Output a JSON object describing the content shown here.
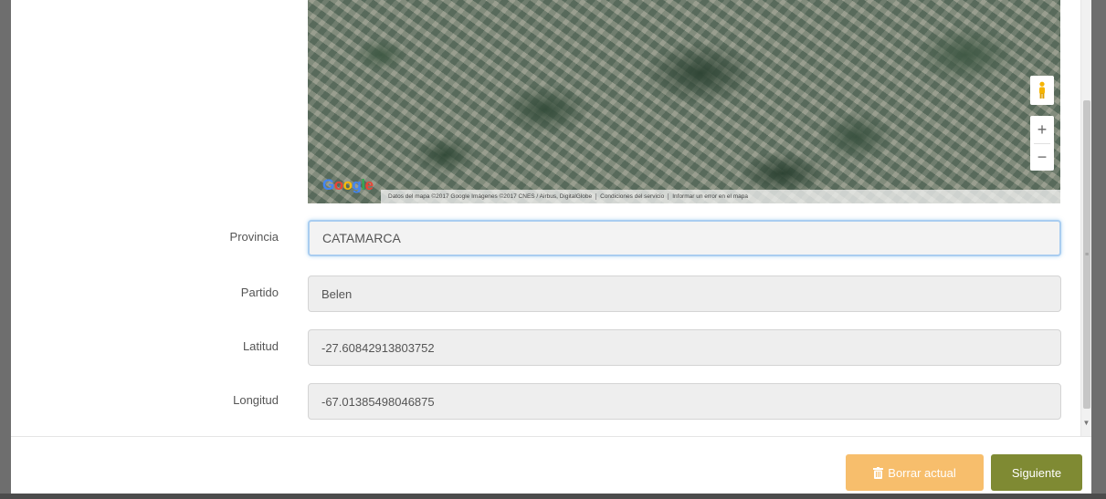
{
  "form": {
    "fields": [
      {
        "label": "Provincia",
        "value": "CATAMARCA"
      },
      {
        "label": "Partido",
        "value": "Belen"
      },
      {
        "label": "Latitud",
        "value": "-27.608429138037​52"
      },
      {
        "label": "Longitud",
        "value": "-67.01385498046875"
      }
    ]
  },
  "map": {
    "zoom_in": "+",
    "zoom_out": "−",
    "google_logo": "Google",
    "attribution": [
      "Datos del mapa ©2017 Google Imágenes ©2017 CNES / Airbus, DigitalGlobe",
      "Condiciones del servicio",
      "Informar un error en el mapa"
    ]
  },
  "footer": {
    "delete_label": "Borrar actual",
    "next_label": "Siguiente"
  },
  "colors": {
    "delete_button": "#f7be6c",
    "next_button": "#7f8a33",
    "focus_border": "#a9cdf0"
  },
  "icons": {
    "pegman": "pegman-icon",
    "trash": "trash-icon",
    "scroll_down": "scroll-down-icon"
  }
}
